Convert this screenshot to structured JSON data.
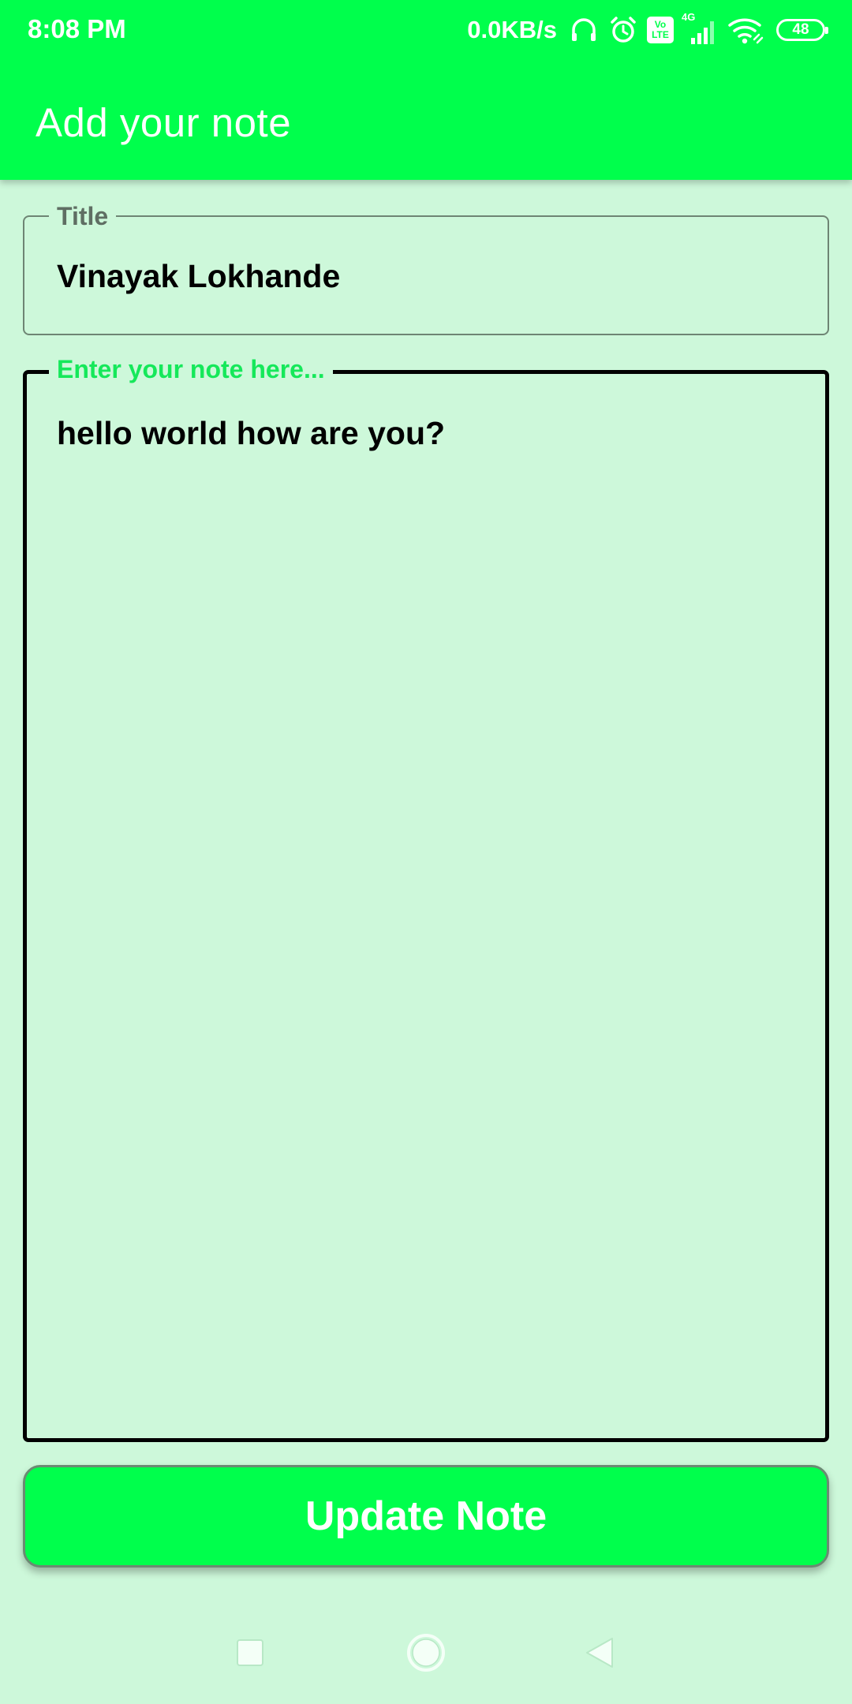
{
  "status_bar": {
    "time": "8:08 PM",
    "net_speed": "0.0KB/s",
    "icons": [
      "headset-icon",
      "alarm-icon",
      "volte-icon",
      "signal-4g-icon",
      "wifi-icon",
      "battery-icon"
    ],
    "volte_top": "Vo",
    "volte_bottom": "LTE",
    "network_type": "4G",
    "battery_level": "48"
  },
  "app_bar": {
    "title": "Add your note"
  },
  "form": {
    "title_field": {
      "label": "Title",
      "value": "Vinayak Lokhande"
    },
    "note_field": {
      "label": "Enter your note here...",
      "value": "hello world how are you?"
    },
    "submit_label": "Update Note"
  },
  "nav_bar": {
    "icons": [
      "recent-apps-icon",
      "home-icon",
      "back-icon"
    ]
  },
  "colors": {
    "primary": "#00ff4c",
    "background": "#cdf8da",
    "focused_label": "#15e85a",
    "text": "#000000"
  }
}
